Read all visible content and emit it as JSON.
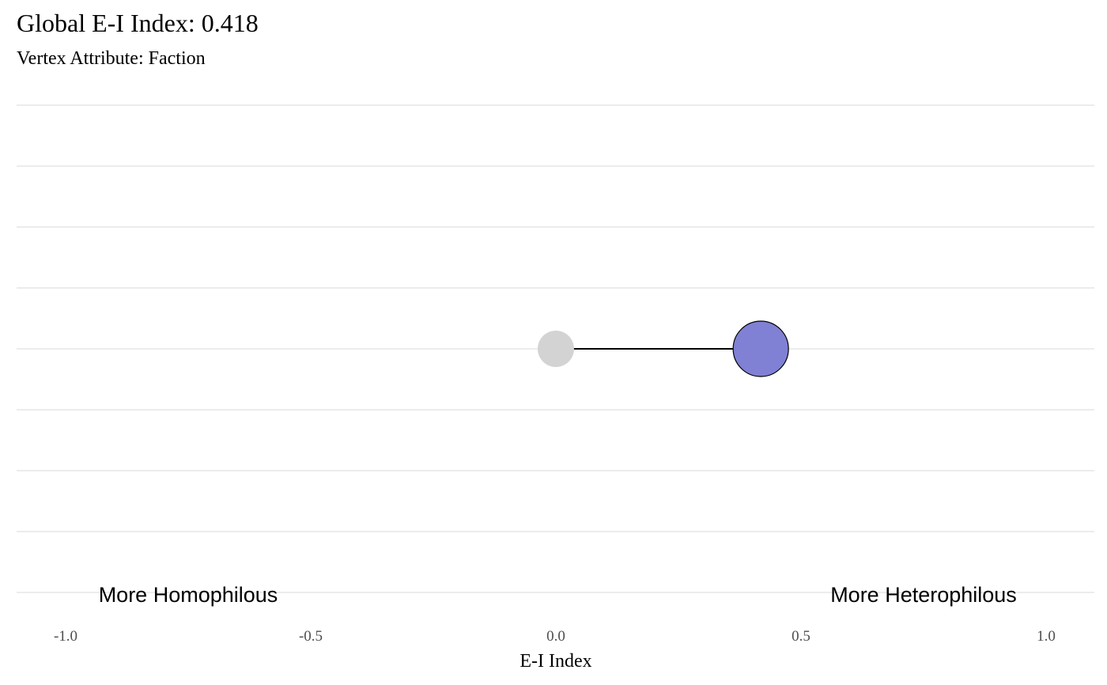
{
  "chart_data": {
    "type": "scatter",
    "title": "Global E-I Index: 0.418",
    "subtitle": "Vertex Attribute: Faction",
    "xlabel": "E-I Index",
    "ylabel": "",
    "xlim": [
      -1.0,
      1.0
    ],
    "x_ticks": [
      -1.0,
      -0.5,
      0.0,
      0.5,
      1.0
    ],
    "x_tick_labels": [
      "-1.0",
      "-0.5",
      "0.0",
      "0.5",
      "1.0"
    ],
    "grid": "horizontal",
    "legend": "none",
    "points": [
      {
        "x": 0.0,
        "color": "#d3d3d3",
        "outline": false,
        "size": "small"
      },
      {
        "x": 0.418,
        "color": "#8080d4",
        "outline": true,
        "size": "large"
      }
    ],
    "segment": {
      "x_start": 0.0,
      "x_end": 0.418,
      "color": "#000000"
    },
    "annotations": [
      {
        "text": "More Homophilous",
        "x": -0.75
      },
      {
        "text": "More Heterophilous",
        "x": 0.75
      }
    ]
  }
}
